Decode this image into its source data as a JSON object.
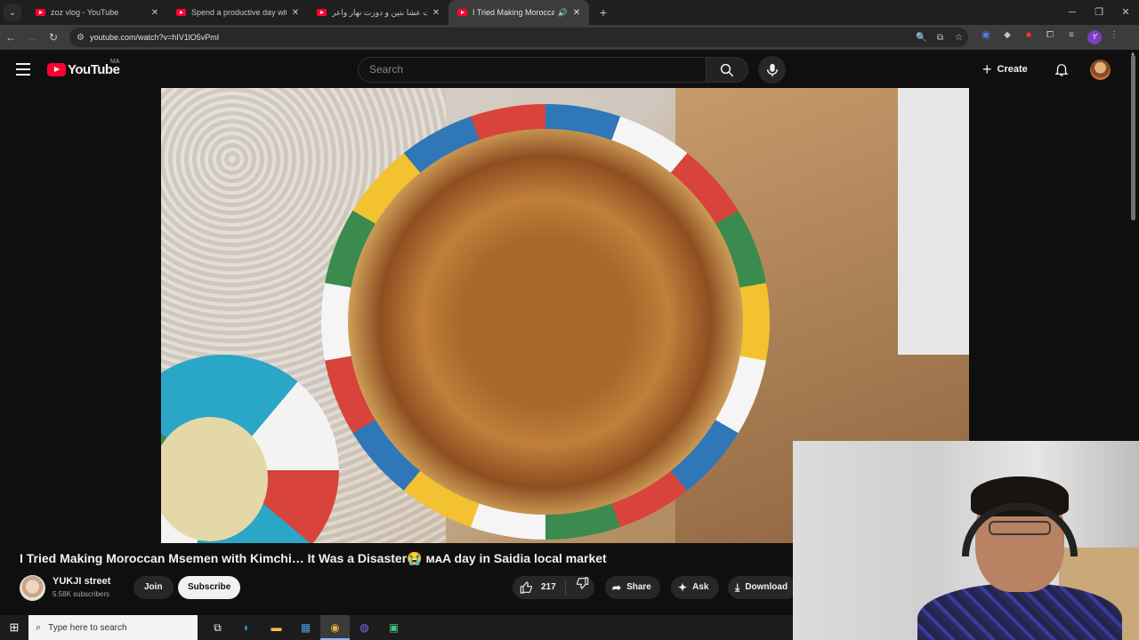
{
  "browser": {
    "tabs": [
      {
        "title": "zoz vlog - YouTube",
        "active": false
      },
      {
        "title": "Spend a productive day with m",
        "active": false
      },
      {
        "title": "طيبت عشا بتين و دوزت نهار واعر",
        "active": false
      },
      {
        "title": "I Tried Making Moroccan M",
        "active": true
      }
    ],
    "url": "youtube.com/watch?v=hIV1lO5vPmI"
  },
  "youtube": {
    "logo_text": "YouTube",
    "country_code": "MA",
    "search_placeholder": "Search",
    "create_label": "Create"
  },
  "video": {
    "title": "I Tried Making Moroccan Msemen with Kimchi… It Was a Disaster😭 ᴍᴀA day in Saidia local market",
    "channel_name": "YUKJI street",
    "subscribers": "5.58K subscribers",
    "join_label": "Join",
    "subscribe_label": "Subscribe",
    "likes": "217",
    "share_label": "Share",
    "ask_label": "Ask",
    "download_label": "Download"
  },
  "taskbar": {
    "search_placeholder": "Type here to search"
  },
  "colors": {
    "accent_red": "#ff0033",
    "background": "#0f0f0f",
    "pill_bg": "#272727"
  }
}
